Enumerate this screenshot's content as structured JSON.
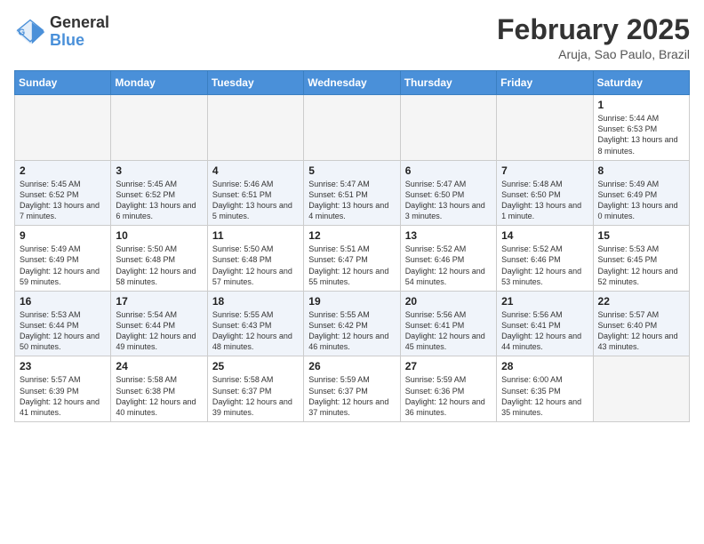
{
  "logo": {
    "general": "General",
    "blue": "Blue"
  },
  "title": {
    "month": "February 2025",
    "location": "Aruja, Sao Paulo, Brazil"
  },
  "weekdays": [
    "Sunday",
    "Monday",
    "Tuesday",
    "Wednesday",
    "Thursday",
    "Friday",
    "Saturday"
  ],
  "weeks": [
    [
      {
        "day": "",
        "info": ""
      },
      {
        "day": "",
        "info": ""
      },
      {
        "day": "",
        "info": ""
      },
      {
        "day": "",
        "info": ""
      },
      {
        "day": "",
        "info": ""
      },
      {
        "day": "",
        "info": ""
      },
      {
        "day": "1",
        "info": "Sunrise: 5:44 AM\nSunset: 6:53 PM\nDaylight: 13 hours and 8 minutes."
      }
    ],
    [
      {
        "day": "2",
        "info": "Sunrise: 5:45 AM\nSunset: 6:52 PM\nDaylight: 13 hours and 7 minutes."
      },
      {
        "day": "3",
        "info": "Sunrise: 5:45 AM\nSunset: 6:52 PM\nDaylight: 13 hours and 6 minutes."
      },
      {
        "day": "4",
        "info": "Sunrise: 5:46 AM\nSunset: 6:51 PM\nDaylight: 13 hours and 5 minutes."
      },
      {
        "day": "5",
        "info": "Sunrise: 5:47 AM\nSunset: 6:51 PM\nDaylight: 13 hours and 4 minutes."
      },
      {
        "day": "6",
        "info": "Sunrise: 5:47 AM\nSunset: 6:50 PM\nDaylight: 13 hours and 3 minutes."
      },
      {
        "day": "7",
        "info": "Sunrise: 5:48 AM\nSunset: 6:50 PM\nDaylight: 13 hours and 1 minute."
      },
      {
        "day": "8",
        "info": "Sunrise: 5:49 AM\nSunset: 6:49 PM\nDaylight: 13 hours and 0 minutes."
      }
    ],
    [
      {
        "day": "9",
        "info": "Sunrise: 5:49 AM\nSunset: 6:49 PM\nDaylight: 12 hours and 59 minutes."
      },
      {
        "day": "10",
        "info": "Sunrise: 5:50 AM\nSunset: 6:48 PM\nDaylight: 12 hours and 58 minutes."
      },
      {
        "day": "11",
        "info": "Sunrise: 5:50 AM\nSunset: 6:48 PM\nDaylight: 12 hours and 57 minutes."
      },
      {
        "day": "12",
        "info": "Sunrise: 5:51 AM\nSunset: 6:47 PM\nDaylight: 12 hours and 55 minutes."
      },
      {
        "day": "13",
        "info": "Sunrise: 5:52 AM\nSunset: 6:46 PM\nDaylight: 12 hours and 54 minutes."
      },
      {
        "day": "14",
        "info": "Sunrise: 5:52 AM\nSunset: 6:46 PM\nDaylight: 12 hours and 53 minutes."
      },
      {
        "day": "15",
        "info": "Sunrise: 5:53 AM\nSunset: 6:45 PM\nDaylight: 12 hours and 52 minutes."
      }
    ],
    [
      {
        "day": "16",
        "info": "Sunrise: 5:53 AM\nSunset: 6:44 PM\nDaylight: 12 hours and 50 minutes."
      },
      {
        "day": "17",
        "info": "Sunrise: 5:54 AM\nSunset: 6:44 PM\nDaylight: 12 hours and 49 minutes."
      },
      {
        "day": "18",
        "info": "Sunrise: 5:55 AM\nSunset: 6:43 PM\nDaylight: 12 hours and 48 minutes."
      },
      {
        "day": "19",
        "info": "Sunrise: 5:55 AM\nSunset: 6:42 PM\nDaylight: 12 hours and 46 minutes."
      },
      {
        "day": "20",
        "info": "Sunrise: 5:56 AM\nSunset: 6:41 PM\nDaylight: 12 hours and 45 minutes."
      },
      {
        "day": "21",
        "info": "Sunrise: 5:56 AM\nSunset: 6:41 PM\nDaylight: 12 hours and 44 minutes."
      },
      {
        "day": "22",
        "info": "Sunrise: 5:57 AM\nSunset: 6:40 PM\nDaylight: 12 hours and 43 minutes."
      }
    ],
    [
      {
        "day": "23",
        "info": "Sunrise: 5:57 AM\nSunset: 6:39 PM\nDaylight: 12 hours and 41 minutes."
      },
      {
        "day": "24",
        "info": "Sunrise: 5:58 AM\nSunset: 6:38 PM\nDaylight: 12 hours and 40 minutes."
      },
      {
        "day": "25",
        "info": "Sunrise: 5:58 AM\nSunset: 6:37 PM\nDaylight: 12 hours and 39 minutes."
      },
      {
        "day": "26",
        "info": "Sunrise: 5:59 AM\nSunset: 6:37 PM\nDaylight: 12 hours and 37 minutes."
      },
      {
        "day": "27",
        "info": "Sunrise: 5:59 AM\nSunset: 6:36 PM\nDaylight: 12 hours and 36 minutes."
      },
      {
        "day": "28",
        "info": "Sunrise: 6:00 AM\nSunset: 6:35 PM\nDaylight: 12 hours and 35 minutes."
      },
      {
        "day": "",
        "info": ""
      }
    ]
  ]
}
